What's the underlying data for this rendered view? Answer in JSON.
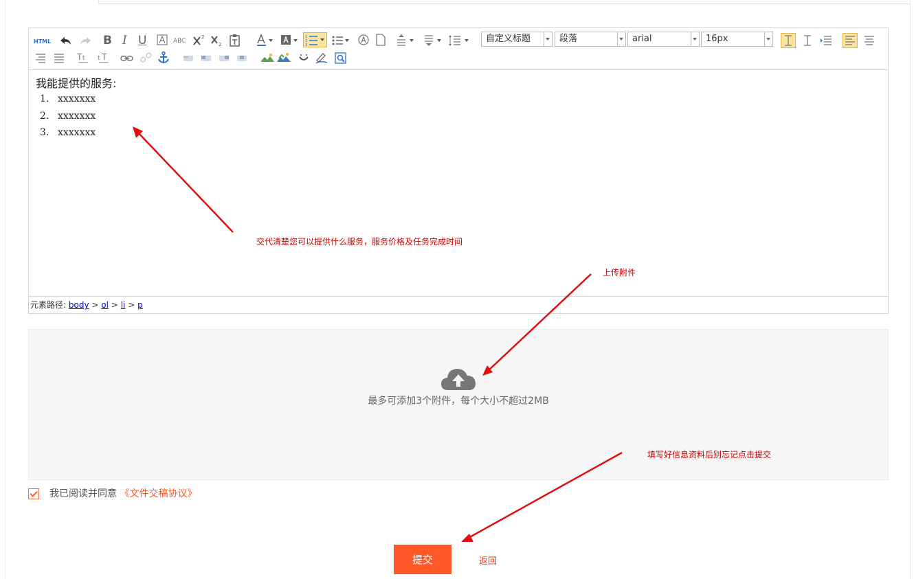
{
  "editor": {
    "toolbar": {
      "html_label": "HTML",
      "bold_label": "B",
      "italic_label": "I",
      "underline_label": "U",
      "abc_label": "ABC",
      "title_select": "自定义标题",
      "paragraph_select": "段落",
      "font_family_select": "arial",
      "font_size_select": "16px"
    },
    "content": {
      "lead": "我能提供的服务:",
      "items": [
        {
          "num": "1.",
          "text": "xxxxxxx"
        },
        {
          "num": "2.",
          "text": "xxxxxxx"
        },
        {
          "num": "3.",
          "text": "xxxxxxx"
        }
      ]
    },
    "path": {
      "label": "元素路径:",
      "items": [
        "body",
        "ol",
        "li",
        "p"
      ],
      "sep": ">"
    }
  },
  "upload": {
    "hint": "最多可添加3个附件，每个大小不超过2MB"
  },
  "agreement": {
    "checked": true,
    "text": "我已阅读并同意",
    "link": "《文件交稿协议》"
  },
  "actions": {
    "submit": "提交",
    "back": "返回"
  },
  "annotations": {
    "service_note": "交代清楚您可以提供什么服务，服务价格及任务完成时间",
    "upload_note": "上传附件",
    "submit_note": "填写好信息资料后别忘记点击提交",
    "color": "#cc0000"
  },
  "colors": {
    "accent": "#ff5726",
    "highlight": "#fbe3a0",
    "upload_bg": "#f6f6f6"
  }
}
